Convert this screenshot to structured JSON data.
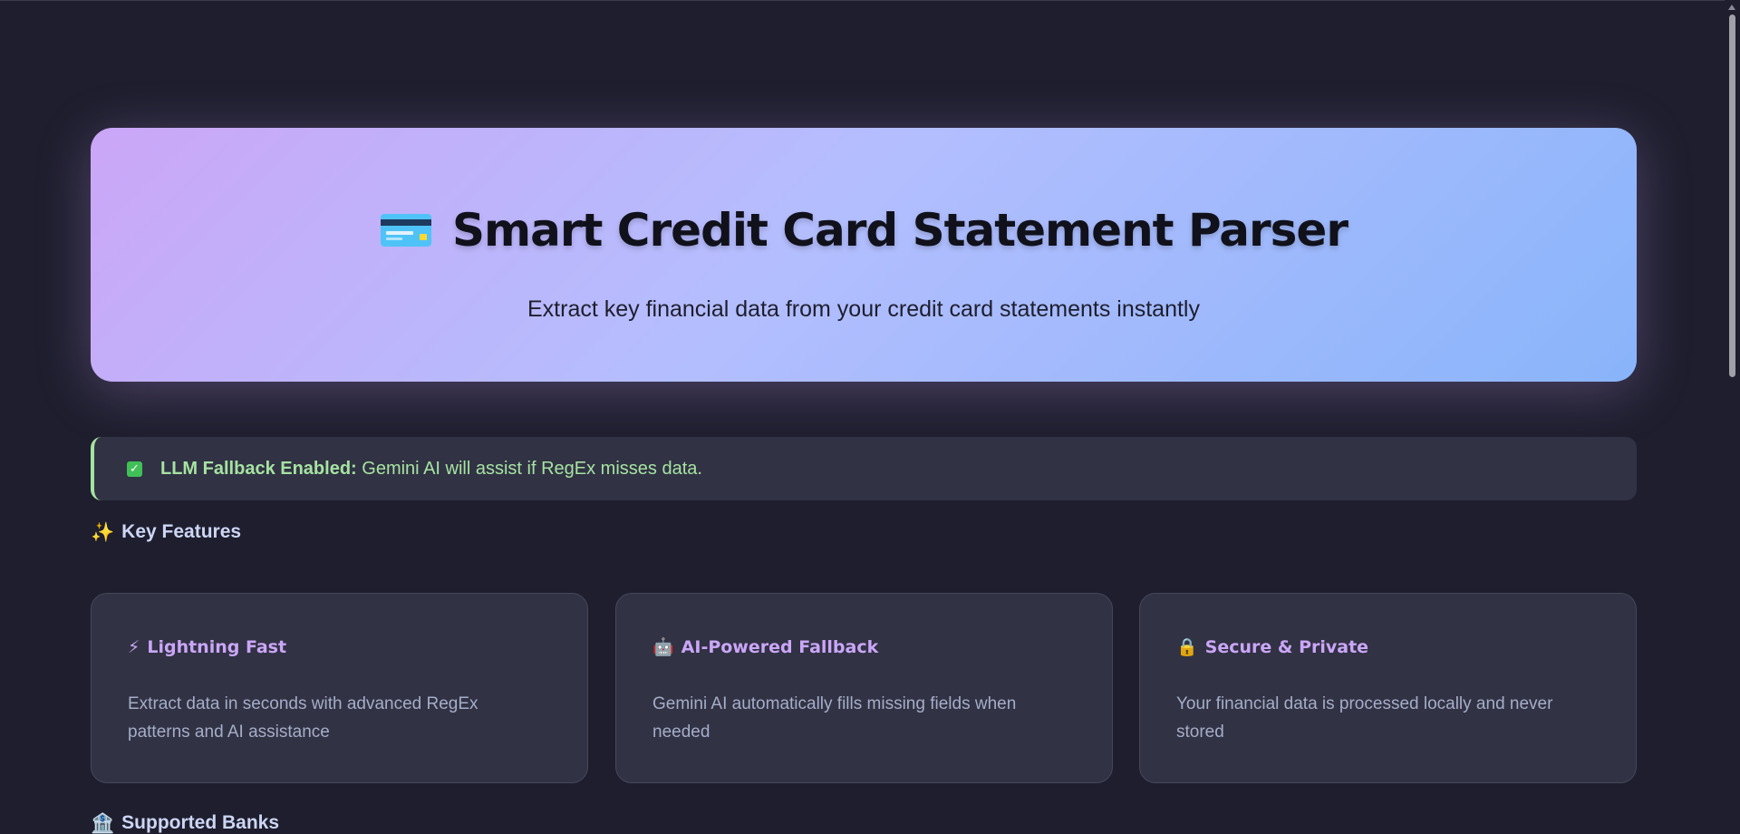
{
  "header": {
    "title": "Smart Credit Card Statement Parser",
    "subtitle": "Extract key financial data from your credit card statements instantly",
    "icon": "credit-card-icon"
  },
  "alert": {
    "icon": "checkbox-checked-icon",
    "label": "LLM Fallback Enabled:",
    "message": "Gemini AI will assist if RegEx misses data.",
    "color": "#a6e3a1"
  },
  "key_features": {
    "heading_icon": "✨",
    "heading": "Key Features",
    "items": [
      {
        "icon": "⚡",
        "title": "Lightning Fast",
        "description": "Extract data in seconds with advanced RegEx patterns and AI assistance"
      },
      {
        "icon": "🤖",
        "title": "AI-Powered Fallback",
        "description": "Gemini AI automatically fills missing fields when needed"
      },
      {
        "icon": "🔒",
        "title": "Secure & Private",
        "description": "Your financial data is processed locally and never stored"
      }
    ]
  },
  "supported_banks": {
    "heading_icon": "🏦",
    "heading": "Supported Banks"
  },
  "theme": {
    "background": "#1e1e2e",
    "accent": "#cba6f7",
    "gradient_end": "#89b4fa"
  }
}
